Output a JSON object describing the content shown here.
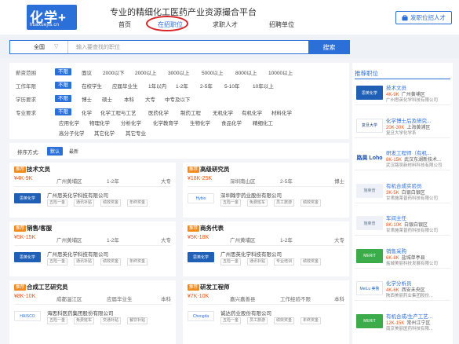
{
  "header": {
    "logo_text": "化学+",
    "logo_sub": "huaxuejia.cn",
    "slogan": "专业的精细化工医药产业资源撮合平台",
    "nav": [
      "首页",
      "在招职位",
      "求职人才",
      "招聘单位"
    ],
    "active_nav": "在招职位",
    "post_button": "发职位招人才",
    "brand_color": "#2b6fd8"
  },
  "search": {
    "region": "全国",
    "placeholder": "输入要查找的职位",
    "button": "搜索"
  },
  "filters": {
    "rows": [
      {
        "label": "薪资范围",
        "options": [
          "不限",
          "面议",
          "2000以下",
          "2000以上",
          "3000以上",
          "5000以上",
          "8000以上",
          "10000以上"
        ]
      },
      {
        "label": "工作年限",
        "options": [
          "不限",
          "在校学生",
          "应届毕业生",
          "1年以内",
          "1-2年",
          "2-5年",
          "5-10年",
          "10年以上"
        ]
      },
      {
        "label": "学历要求",
        "options": [
          "不限",
          "博士",
          "硕士",
          "本科",
          "大专",
          "中专及以下"
        ]
      },
      {
        "label": "专业要求",
        "options": [
          "不限",
          "化学",
          "化学工程与工艺",
          "医药化学",
          "制药工程",
          "无机化学",
          "有机化学",
          "材料化学"
        ]
      },
      {
        "label": "",
        "options": [
          "应用化学",
          "物理化学",
          "分析化学",
          "化学教育学",
          "生物化学",
          "食品化学",
          "精细化工"
        ]
      },
      {
        "label": "",
        "options": [
          "高分子化学",
          "其它化学",
          "其它专业"
        ]
      }
    ]
  },
  "sort": {
    "label": "排序方式:",
    "options": [
      "默认",
      "最新"
    ]
  },
  "jobs": [
    {
      "tag": "推荐",
      "title": "技术文员",
      "salary": "¥4K-9K",
      "location": "广州黄埔区",
      "experience": "1-2年",
      "education": "大专",
      "company": "广州思英化学科技有限公司",
      "perks": [
        "五险一金",
        "通讯补贴",
        "绩效奖金",
        "年终奖金"
      ],
      "logo_text": "思英化学",
      "logo_color": "#1f5fb5"
    },
    {
      "tag": "推荐",
      "title": "高级研究员",
      "salary": "¥18K-25K",
      "location": "深圳南山区",
      "experience": "2-5年",
      "education": "博士",
      "company": "深圳翰宇药业股份有限公司",
      "perks": [
        "五险一金",
        "免费班车",
        "员工旅游",
        "绩效奖金"
      ],
      "logo_text": "Hybio",
      "logo_color": "#ffffff"
    },
    {
      "tag": "推荐",
      "title": "销售/客服",
      "salary": "¥5K-15K",
      "location": "广州黄埔区",
      "experience": "1-2年",
      "education": "大专",
      "company": "广州思英化学科技有限公司",
      "perks": [
        "五险一金",
        "通讯补贴",
        "绩效奖金",
        "年终奖金"
      ],
      "logo_text": "思英化学",
      "logo_color": "#1f5fb5"
    },
    {
      "tag": "推荐",
      "title": "商务代表",
      "salary": "¥5K-18K",
      "location": "广州黄埔区",
      "experience": "1-2年",
      "education": "大专",
      "company": "广州思英化学科技有限公司",
      "perks": [
        "五险一金",
        "通讯补贴",
        "专业培训",
        "绩效奖金"
      ],
      "logo_text": "思英化学",
      "logo_color": "#1f5fb5"
    },
    {
      "tag": "推荐",
      "title": "合成工艺研究员",
      "salary": "¥8K-10K",
      "location": "成都温江区",
      "experience": "应届毕业生",
      "education": "本科",
      "company": "海思科医药集团股份有限公司",
      "perks": [
        "五险一金",
        "免费班车",
        "交通补贴",
        "餐饮补贴"
      ],
      "logo_text": "HAISCO",
      "logo_color": "#ffffff"
    },
    {
      "tag": "推荐",
      "title": "研发工程师",
      "salary": "¥7K-10K",
      "location": "嘉兴嘉善县",
      "experience": "工作经验不限",
      "education": "本科",
      "company": "诚达药业股份有限公司",
      "perks": [
        "五险一金",
        "员工旅游",
        "绩效奖金",
        "年终奖金"
      ],
      "logo_text": "Chengda",
      "logo_color": "#ffffff"
    }
  ],
  "sidebar": {
    "title": "推荐职位",
    "items": [
      {
        "title": "技术文员",
        "salary": "4K-9K",
        "location": "广州黄埔区",
        "company": "广州思英化学科技有限公司",
        "logo_text": "思英化学"
      },
      {
        "title": "化学博士后及研究...",
        "salary": "20K-30K",
        "location": "上海黄浦区",
        "company": "复旦大学化学系",
        "logo_text": "复旦大学"
      },
      {
        "title": "研发工程师（有机...",
        "salary": "8K-15K",
        "location": "武汉东湖新技术...",
        "company": "武汉路吴新材料科技有限公司",
        "logo_text": "路昊 Loho"
      },
      {
        "title": "有机合成实验员",
        "salary": "3K-5K",
        "location": "白银白银区",
        "company": "甘肃施莱普药科技有限公司",
        "logo_text": "施莱普"
      },
      {
        "title": "车间主任",
        "salary": "8K-10K",
        "location": "白银白银区",
        "company": "甘肃施莱普药科技有限公司",
        "logo_text": "施莱普"
      },
      {
        "title": "销售采购",
        "salary": "6K-8K",
        "location": "盐城单亭县",
        "company": "盐城美丽科技发展有限公司",
        "logo_text": "MERIT"
      },
      {
        "title": "化学分析员",
        "salary": "4K-6K",
        "location": "西安未央区",
        "company": "陕西美丽药业集团股份...",
        "logo_text": "MeiLu 美鲁"
      },
      {
        "title": "有机合成/生产工艺...",
        "salary": "12K-15K",
        "location": "常州江宁区",
        "company": "南京美丽医药科技有限...",
        "logo_text": "MERIT"
      }
    ]
  }
}
